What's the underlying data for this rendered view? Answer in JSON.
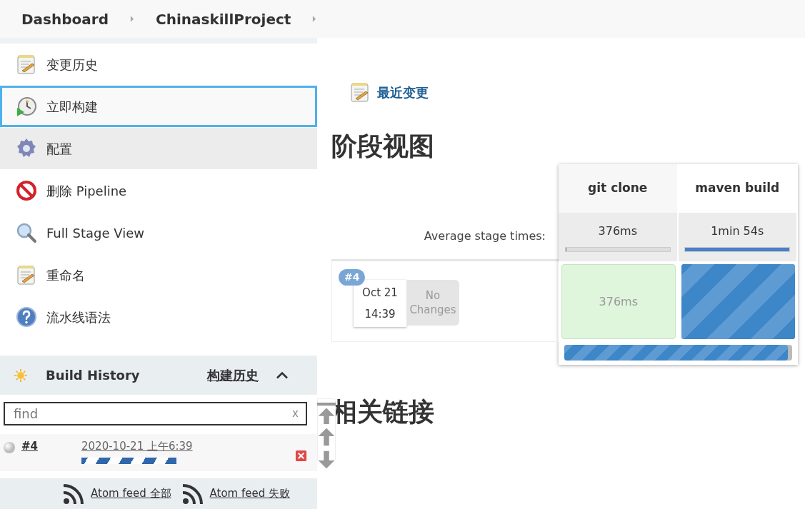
{
  "breadcrumbs": [
    {
      "label": "Dashboard"
    },
    {
      "label": "ChinaskillProject"
    }
  ],
  "tasks": [
    {
      "label": "变更历史",
      "selected": false,
      "hovered": false
    },
    {
      "label": "立即构建",
      "selected": true,
      "hovered": false
    },
    {
      "label": "配置",
      "selected": false,
      "hovered": true
    },
    {
      "label": "删除 Pipeline",
      "selected": false,
      "hovered": false
    },
    {
      "label": "Full Stage View",
      "selected": false,
      "hovered": false
    },
    {
      "label": "重命名",
      "selected": false,
      "hovered": false
    },
    {
      "label": "流水线语法",
      "selected": false,
      "hovered": false
    }
  ],
  "build_history": {
    "title": "Build History",
    "trend_link": "构建历史",
    "expanded": true,
    "search": {
      "placeholder": "find",
      "clear": "x"
    },
    "builds": [
      {
        "number": "#4",
        "date": "2020-10-21 上午6:39",
        "running": true
      }
    ],
    "feeds": [
      "Atom feed 全部",
      "Atom feed 失败"
    ]
  },
  "main": {
    "recent_changes": "最近变更",
    "stage_view_title": "阶段视图",
    "stage_view": {
      "average_label": "Average stage times:",
      "stages": [
        {
          "name": "git clone",
          "average": "376ms",
          "level": 0.01
        },
        {
          "name": "maven build",
          "average": "1min 54s",
          "level": 1
        }
      ],
      "builds": [
        {
          "badge": "#4",
          "date": "Oct 21",
          "time": "14:39",
          "changes": "No Changes",
          "level": 0.98,
          "cells": [
            {
              "kind": "success",
              "text": "376ms"
            },
            {
              "kind": "running"
            }
          ]
        }
      ]
    },
    "links_title": "相关链接"
  }
}
